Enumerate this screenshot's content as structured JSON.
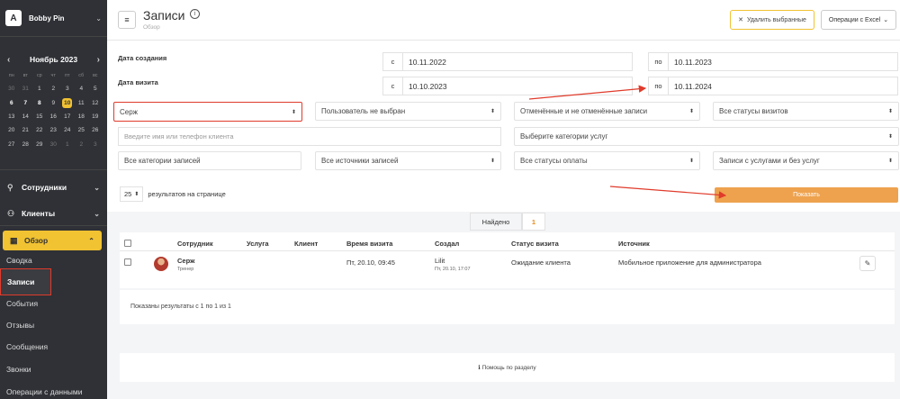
{
  "brand": {
    "name": "Bobby Pin",
    "logo_glyph": "A"
  },
  "calendar": {
    "month": "Ноябрь 2023",
    "prev_icon": "chevron-left-icon",
    "next_icon": "chevron-right-icon",
    "dow": [
      "пн",
      "вт",
      "ср",
      "чт",
      "пт",
      "сб",
      "вс"
    ],
    "weeks": [
      [
        "30",
        "31",
        "1",
        "2",
        "3",
        "4",
        "5"
      ],
      [
        "6",
        "7",
        "8",
        "9",
        "10",
        "11",
        "12"
      ],
      [
        "13",
        "14",
        "15",
        "16",
        "17",
        "18",
        "19"
      ],
      [
        "20",
        "21",
        "22",
        "23",
        "24",
        "25",
        "26"
      ],
      [
        "27",
        "28",
        "29",
        "30",
        "1",
        "2",
        "3"
      ]
    ],
    "today": "10",
    "accent": "#f1c232"
  },
  "nav": {
    "employees": "Сотрудники",
    "clients": "Клиенты",
    "overview": "Обзор",
    "sub_items": [
      "Сводка",
      "Записи",
      "События",
      "Отзывы",
      "Сообщения",
      "Звонки",
      "Операции с данными"
    ]
  },
  "header": {
    "title": "Записи",
    "subtitle": "Обзор",
    "delete_label": "Удалить выбранные",
    "excel_label": "Операции с Excel"
  },
  "filters": {
    "created_label": "Дата создания",
    "visit_label": "Дата визита",
    "from": "с",
    "to": "по",
    "created_from": "10.11.2022",
    "created_to": "10.11.2023",
    "visit_from": "10.10.2023",
    "visit_to": "10.11.2024",
    "employee": "Серж",
    "user": "Пользователь не выбран",
    "cancelled": "Отменённые и не отменённые записи",
    "visit_status": "Все статусы визитов",
    "client_placeholder": "Введите имя или телефон клиента",
    "service_categories": "Выберите категории услуг",
    "record_categories": "Все категории записей",
    "sources": "Все источники записей",
    "payment_status": "Все статусы оплаты",
    "services": "Записи с услугами и без услуг",
    "per_page": "25",
    "per_page_label": "результатов на странице",
    "show_button": "Показать",
    "show_color": "#eea24e"
  },
  "found": {
    "label": "Найдено",
    "count": "1"
  },
  "table": {
    "headers": [
      "Сотрудник",
      "Услуга",
      "Клиент",
      "Время визита",
      "Создал",
      "Статус визита",
      "Источник"
    ],
    "rows": [
      {
        "employee": "Серж",
        "role": "Тренер",
        "service": "",
        "client": "",
        "visit_time": "Пт, 20.10, 09:45",
        "created_by": "Lilit",
        "created_at": "Пт, 20.10, 17:07",
        "status": "Ожидание клиента",
        "source": "Мобильное приложение для администратора"
      }
    ]
  },
  "results_text": "Показаны результаты с 1 по 1 из 1",
  "help_text": "Помощь по разделу"
}
